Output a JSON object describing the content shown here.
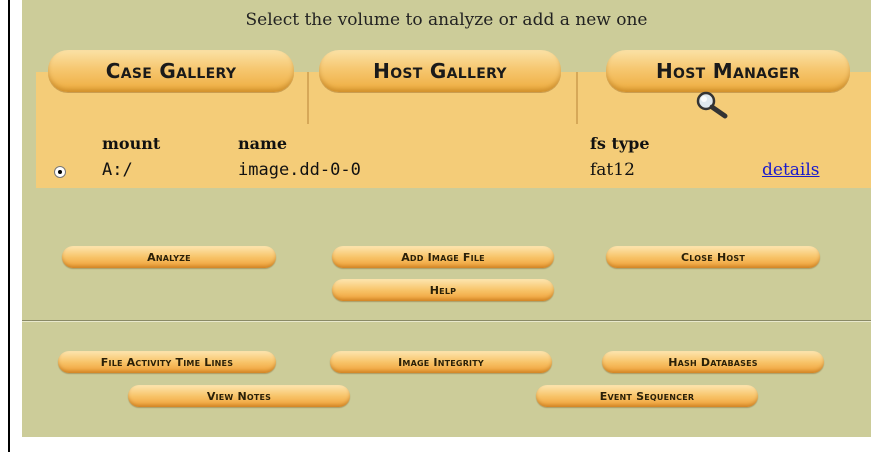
{
  "header": {
    "text": "Select the volume to analyze or add a new one"
  },
  "tabs": [
    {
      "label": "Case Gallery"
    },
    {
      "label": "Host Gallery"
    },
    {
      "label": "Host Manager"
    }
  ],
  "volume_table": {
    "columns": [
      "mount",
      "name",
      "fs type"
    ],
    "rows": [
      {
        "mount": "A:/",
        "name": "image.dd-0-0",
        "fs_type": "fat12",
        "link": "details",
        "selected": true
      }
    ]
  },
  "actions": {
    "analyze": "Analyze",
    "add_image_file": "Add Image File",
    "close_host": "Close Host",
    "help": "Help"
  },
  "tools": {
    "file_activity": "File Activity Time Lines",
    "image_integrity": "Image Integrity",
    "hash_databases": "Hash Databases",
    "view_notes": "View Notes",
    "event_sequencer": "Event Sequencer"
  },
  "colors": {
    "panel": "#cccc99",
    "tab_bg": "#f4cc78",
    "button": "#f8c46a",
    "link": "#1a1acc"
  }
}
